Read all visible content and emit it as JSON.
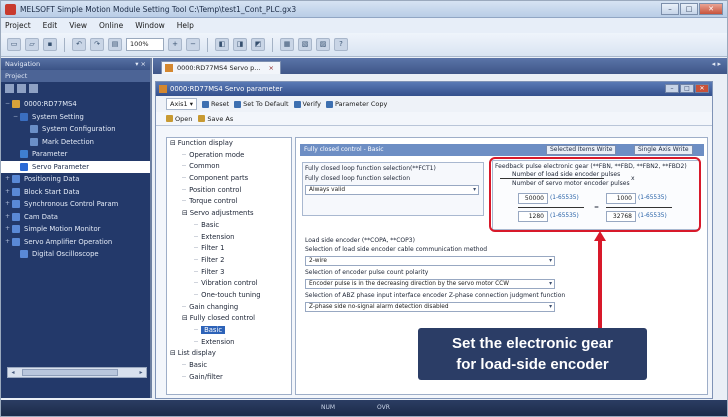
{
  "window": {
    "title": "MELSOFT Simple Motion Module Setting Tool C:\\Temp\\test1_Cont_PLC.gx3",
    "min": "–",
    "max": "□",
    "close": "✕"
  },
  "menu": [
    "Project",
    "Edit",
    "View",
    "Online",
    "Window",
    "Help"
  ],
  "toolbar": {
    "zoom": "100%"
  },
  "navigation": {
    "title": "Navigation",
    "pin": "▾ ×",
    "subtitle": "Project",
    "items": [
      {
        "label": "0000:RD77MS4",
        "expander": "−"
      },
      {
        "label": "System Setting",
        "expander": "−"
      },
      {
        "label": "System Configuration",
        "expander": ""
      },
      {
        "label": "Mark Detection",
        "expander": ""
      },
      {
        "label": "Parameter",
        "expander": ""
      },
      {
        "label": "Servo Parameter",
        "expander": "",
        "selected": true
      },
      {
        "label": "Positioning Data",
        "expander": "+"
      },
      {
        "label": "Block Start Data",
        "expander": "+"
      },
      {
        "label": "Synchronous Control Param",
        "expander": "+"
      },
      {
        "label": "Cam Data",
        "expander": "+"
      },
      {
        "label": "Simple Motion Monitor",
        "expander": "+"
      },
      {
        "label": "Servo Amplifier Operation",
        "expander": "+"
      },
      {
        "label": "Digital Oscilloscope",
        "expander": ""
      }
    ]
  },
  "tab": {
    "label": "0000:RD77MS4 Servo p...",
    "close": "×",
    "pin": "◂ ▸"
  },
  "child_window": {
    "title": "0000:RD77MS4 Servo parameter",
    "axis_select": "Axis1",
    "buttons": [
      "Reset",
      "Set To Default",
      "Verify",
      "Parameter Copy"
    ],
    "buttons2": [
      "Open",
      "Save As"
    ]
  },
  "param_tree": [
    {
      "label": "Function display",
      "indent": 0,
      "prefix": "⊟"
    },
    {
      "label": "Operation mode",
      "indent": 1,
      "prefix": ""
    },
    {
      "label": "Common",
      "indent": 1,
      "prefix": ""
    },
    {
      "label": "Component parts",
      "indent": 1,
      "prefix": ""
    },
    {
      "label": "Position control",
      "indent": 1,
      "prefix": ""
    },
    {
      "label": "Torque control",
      "indent": 1,
      "prefix": ""
    },
    {
      "label": "Servo adjustments",
      "indent": 1,
      "prefix": "⊟"
    },
    {
      "label": "Basic",
      "indent": 2,
      "prefix": ""
    },
    {
      "label": "Extension",
      "indent": 2,
      "prefix": ""
    },
    {
      "label": "Filter 1",
      "indent": 2,
      "prefix": ""
    },
    {
      "label": "Filter 2",
      "indent": 2,
      "prefix": ""
    },
    {
      "label": "Filter 3",
      "indent": 2,
      "prefix": ""
    },
    {
      "label": "Vibration control",
      "indent": 2,
      "prefix": ""
    },
    {
      "label": "One-touch tuning",
      "indent": 2,
      "prefix": ""
    },
    {
      "label": "Gain changing",
      "indent": 1,
      "prefix": ""
    },
    {
      "label": "Fully closed control",
      "indent": 1,
      "prefix": "⊟"
    },
    {
      "label": "Basic",
      "indent": 2,
      "prefix": "",
      "selected": true
    },
    {
      "label": "Extension",
      "indent": 2,
      "prefix": ""
    },
    {
      "label": "List display",
      "indent": 0,
      "prefix": "⊟"
    },
    {
      "label": "Basic",
      "indent": 1,
      "prefix": ""
    },
    {
      "label": "Gain/filter",
      "indent": 1,
      "prefix": ""
    }
  ],
  "panel": {
    "header": "Fully closed control - Basic",
    "selected_items_write": "Selected Items Write",
    "single_axis_write": "Single Axis Write",
    "fcl_title": "Fully closed loop function selection(**FCT1)",
    "fcl_sub": "Fully closed loop function selection",
    "fcl_value": "Always valid",
    "gear_title": "Feedback pulse electronic gear (**FBN, **FBD, **FBN2, **FBD2)",
    "gear_num_label": "Number of load side encoder pulses",
    "gear_den_label": "Number of servo motor encoder pulses",
    "gear_values": [
      "50000",
      "1000",
      "1280",
      "32768"
    ],
    "gear_range": "(1-65535)",
    "gear_x": "x",
    "gear_eq": "=",
    "load_title": "Load side encoder (**COPA, **COP3)",
    "load_sel1": "Selection of load side encoder cable communication method",
    "load_val1": "2-wire",
    "load_sel2": "Selection of encoder pulse count polarity",
    "load_val2": "Encoder pulse is in the decreasing direction by the servo motor CCW",
    "load_sel3": "Selection of ABZ phase input interface encoder Z-phase connection judgment function",
    "load_val3": "Z-phase side no-signal alarm detection disabled"
  },
  "callout": {
    "line1": "Set the electronic gear",
    "line2": "for load-side encoder"
  },
  "accent_colors": {
    "highlight_box": "#d8192a",
    "callout_bg": "#142855"
  },
  "status": [
    "NUM",
    "OVR"
  ]
}
